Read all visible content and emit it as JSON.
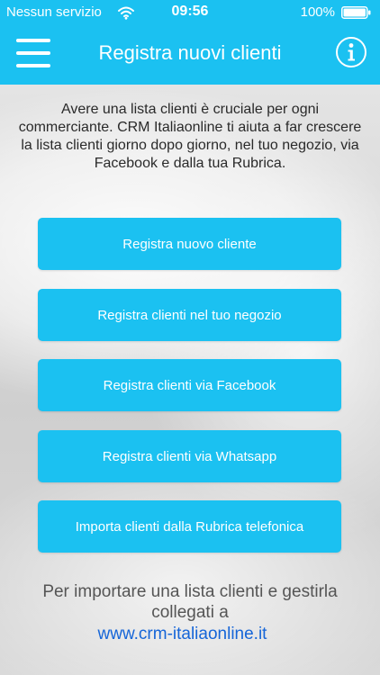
{
  "status_bar": {
    "carrier": "Nessun servizio",
    "time": "09:56",
    "battery": "100%"
  },
  "nav": {
    "title": "Registra nuovi clienti",
    "menu_icon": "hamburger-menu-icon",
    "info_icon": "info-icon"
  },
  "intro": {
    "text": "Avere una lista clienti è cruciale per ogni commerciante. CRM Italiaonline ti aiuta a far crescere la lista clienti giorno dopo giorno, nel tuo negozio, via Facebook e dalla tua Rubrica."
  },
  "buttons": [
    {
      "label": "Registra nuovo cliente"
    },
    {
      "label": "Registra clienti nel tuo negozio"
    },
    {
      "label": "Registra clienti via Facebook"
    },
    {
      "label": "Registra clienti via Whatsapp"
    },
    {
      "label": "Importa clienti dalla Rubrica telefonica"
    }
  ],
  "footer": {
    "text": "Per importare una lista clienti e gestirla collegati a",
    "link": "www.crm-italiaonline.it"
  },
  "colors": {
    "brand": "#1bc1f1",
    "link": "#1565d8",
    "text": "#2a2a2a"
  }
}
